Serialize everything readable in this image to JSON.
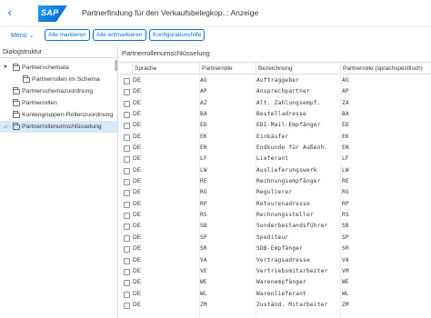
{
  "header": {
    "back_icon": "back-arrow-icon",
    "logo_text": "SAP",
    "title": "Partnerfindung für den Verkaufsbelegkop..: Anzeige"
  },
  "toolbar": {
    "menu_label": "Menü ⌄",
    "select_all": "Alle markieren",
    "deselect_all": "Alle entmarkieren",
    "config_help": "Konfigurationshilfe"
  },
  "left_panel": {
    "heading": "Dialogstruktur",
    "items": [
      {
        "label": "Partnerschemata"
      },
      {
        "label": "Partnerrollen im Schema"
      },
      {
        "label": "Partnerschemazuordnung"
      },
      {
        "label": "Partnerrollen"
      },
      {
        "label": "Kontengruppen-Rollenzuordnung"
      },
      {
        "label": "Partnerrollenumschlüsselung"
      }
    ]
  },
  "right_panel": {
    "title": "Partnerrollenumschlüsselung",
    "columns": {
      "sprache": "Sprache",
      "rolle": "Partnerrolle",
      "bezeichnung": "Bezeichnung",
      "rolle_spez": "Partnerrolle (sprachspezifisch)"
    },
    "rows": [
      {
        "lang": "DE",
        "role": "AG",
        "desc": "Auftraggeber",
        "role2": "AG"
      },
      {
        "lang": "DE",
        "role": "AP",
        "desc": "Ansprechpartner",
        "role2": "AP"
      },
      {
        "lang": "DE",
        "role": "AZ",
        "desc": "Alt. Zahlungsempf.",
        "role2": "ZA"
      },
      {
        "lang": "DE",
        "role": "BA",
        "desc": "Bestelladresse",
        "role2": "BA"
      },
      {
        "lang": "DE",
        "role": "ED",
        "desc": "EDI-Mail-Empfänger",
        "role2": "ED"
      },
      {
        "lang": "DE",
        "role": "EK",
        "desc": "Einkäufer",
        "role2": "EK"
      },
      {
        "lang": "DE",
        "role": "EN",
        "desc": "Endkunde für Außenh.",
        "role2": "EN"
      },
      {
        "lang": "DE",
        "role": "LF",
        "desc": "Lieferant",
        "role2": "LF"
      },
      {
        "lang": "DE",
        "role": "LW",
        "desc": "Auslieferungswerk",
        "role2": "LW"
      },
      {
        "lang": "DE",
        "role": "RE",
        "desc": "Rechnungsempfänger",
        "role2": "RE"
      },
      {
        "lang": "DE",
        "role": "RG",
        "desc": "Regulierer",
        "role2": "RG"
      },
      {
        "lang": "DE",
        "role": "RP",
        "desc": "Retourenadresse",
        "role2": "RP"
      },
      {
        "lang": "DE",
        "role": "RS",
        "desc": "Rechnungssteller",
        "role2": "RS"
      },
      {
        "lang": "DE",
        "role": "SB",
        "desc": "Sonderbestandsführer",
        "role2": "SB"
      },
      {
        "lang": "DE",
        "role": "SP",
        "desc": "Spediteur",
        "role2": "SP"
      },
      {
        "lang": "DE",
        "role": "SR",
        "desc": "SDB-Empfänger",
        "role2": "SR"
      },
      {
        "lang": "DE",
        "role": "VA",
        "desc": "Vertragsadresse",
        "role2": "VA"
      },
      {
        "lang": "DE",
        "role": "VE",
        "desc": "Vertriebsmitarbeiter",
        "role2": "VM"
      },
      {
        "lang": "DE",
        "role": "WE",
        "desc": "Warenempfänger",
        "role2": "WE"
      },
      {
        "lang": "DE",
        "role": "WL",
        "desc": "Warenlieferant",
        "role2": "WL"
      },
      {
        "lang": "DE",
        "role": "ZM",
        "desc": "Zuständ. Mitarbeiter",
        "role2": "ZM"
      }
    ]
  }
}
